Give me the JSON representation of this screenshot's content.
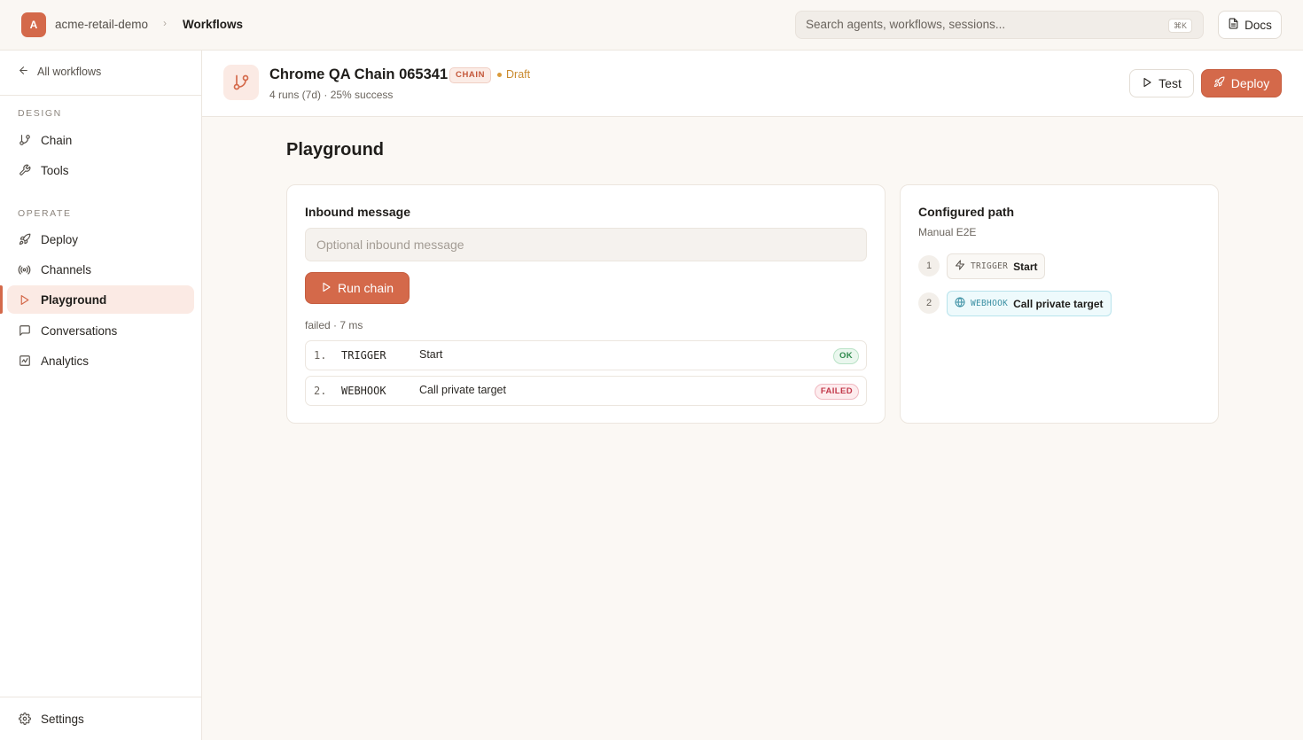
{
  "topbar": {
    "org_initial": "A",
    "org_name": "acme-retail-demo",
    "crumb_separator": "›",
    "crumb_current": "Workflows",
    "search_placeholder": "Search agents, workflows, sessions...",
    "search_shortcut": "⌘K",
    "docs_label": "Docs"
  },
  "sidebar": {
    "back_label": "All workflows",
    "sections": [
      {
        "title": "DESIGN",
        "items": [
          {
            "label": "Chain",
            "icon": "git-branch-icon"
          },
          {
            "label": "Tools",
            "icon": "wrench-icon"
          }
        ]
      },
      {
        "title": "OPERATE",
        "items": [
          {
            "label": "Deploy",
            "icon": "rocket-icon"
          },
          {
            "label": "Channels",
            "icon": "broadcast-icon"
          },
          {
            "label": "Playground",
            "icon": "play-icon",
            "active": true
          },
          {
            "label": "Conversations",
            "icon": "message-square-icon"
          },
          {
            "label": "Analytics",
            "icon": "activity-chart-icon"
          }
        ]
      }
    ],
    "settings_label": "Settings"
  },
  "header": {
    "title": "Chrome QA Chain 065341",
    "badge": "CHAIN",
    "status": "Draft",
    "subtitle": "4 runs (7d) · 25% success",
    "test_label": "Test",
    "deploy_label": "Deploy"
  },
  "main": {
    "title": "Playground",
    "inbound": {
      "label": "Inbound message",
      "placeholder": "Optional inbound message",
      "value": "",
      "run_label": "Run chain",
      "result_meta": "failed · 7 ms",
      "steps": [
        {
          "num": "1.",
          "type": "TRIGGER",
          "label": "Start",
          "status": "OK"
        },
        {
          "num": "2.",
          "type": "WEBHOOK",
          "label": "Call private target",
          "status": "FAILED"
        }
      ]
    },
    "path": {
      "title": "Configured path",
      "subtitle": "Manual E2E",
      "nodes": [
        {
          "num": "1",
          "type": "TRIGGER",
          "label": "Start"
        },
        {
          "num": "2",
          "type": "WEBHOOK",
          "label": "Call private target"
        }
      ]
    }
  },
  "colors": {
    "accent": "#d4694a",
    "ok": "#2f8a4d",
    "failed": "#c2384a",
    "draft": "#c98a2e"
  }
}
